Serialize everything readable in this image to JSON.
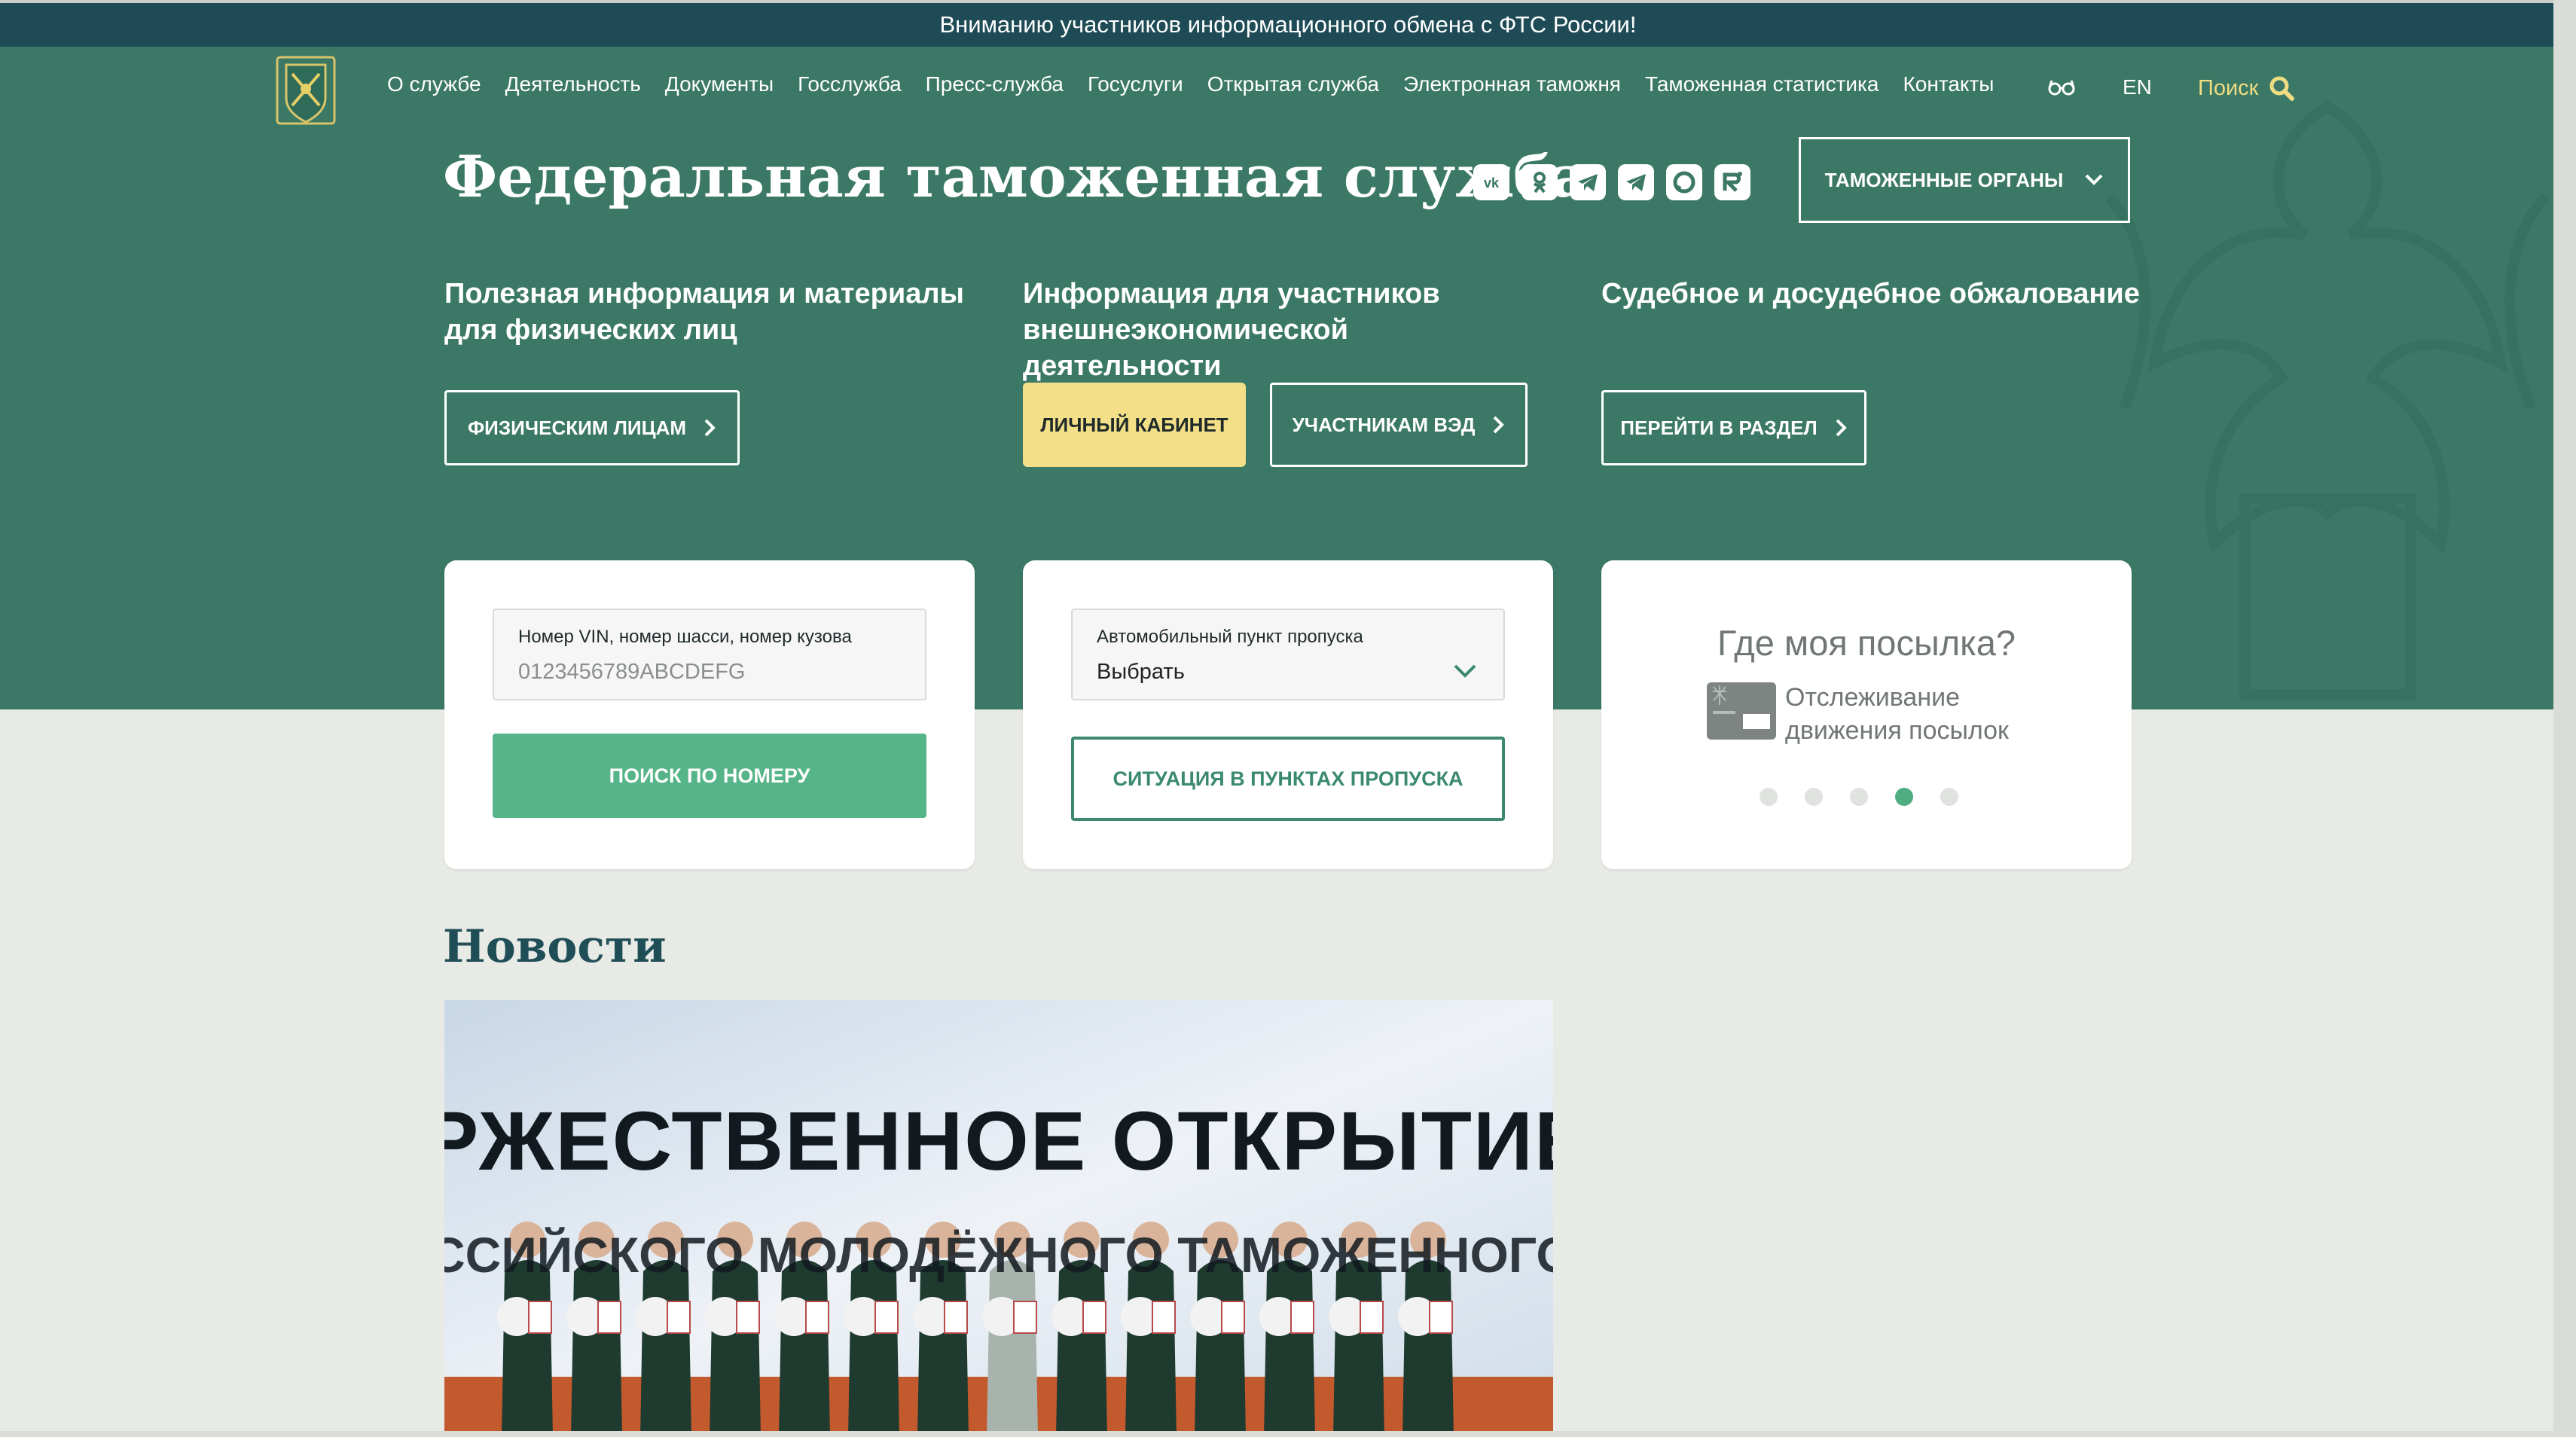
{
  "announcement": "Вниманию участников информационного обмена с ФТС России!",
  "nav": {
    "items": [
      "О службе",
      "Деятельность",
      "Документы",
      "Госслужба",
      "Пресс-служба",
      "Госуслуги",
      "Открытая служба",
      "Электронная таможня",
      "Таможенная статистика",
      "Контакты"
    ],
    "lang": "EN",
    "search_label": "Поиск"
  },
  "site_title": "Федеральная таможенная служба",
  "socials": [
    "vk-icon",
    "odnoklassniki-icon",
    "telegram-icon",
    "telegram-icon",
    "max-icon",
    "rutube-icon"
  ],
  "customs_bodies_label": "ТАМОЖЕННЫЕ ОРГАНЫ",
  "sections": {
    "individuals": {
      "title": "Полезная информация и материалы для физических лиц",
      "button": "ФИЗИЧЕСКИМ ЛИЦАМ"
    },
    "foreign_trade": {
      "title": "Информация для участников внешнеэкономической деятельности",
      "cabinet_button": "ЛИЧНЫЙ КАБИНЕТ",
      "button": "УЧАСТНИКАМ ВЭД"
    },
    "appeal": {
      "title": "Судебное и досудебное обжалование",
      "button": "ПЕРЕЙТИ В РАЗДЕЛ"
    }
  },
  "vin_card": {
    "label": "Номер VIN, номер шасси, номер кузова",
    "placeholder": "0123456789ABCDEFG",
    "button": "ПОИСК ПО НОМЕРУ"
  },
  "checkpoint_card": {
    "label": "Автомобильный пункт пропуска",
    "selected": "Выбрать",
    "button": "СИТУАЦИЯ В ПУНКТАХ ПРОПУСКА"
  },
  "parcel_card": {
    "title": "Где моя посылка?",
    "subtitle_line1": "Отслеживание",
    "subtitle_line2": "движения посылок",
    "slide_count": 5,
    "active_slide": 4
  },
  "news": {
    "title": "Новости",
    "banner_line1": "РЖЕСТВЕННОЕ ОТКРЫТИЕ",
    "banner_line2": "ССИЙСКОГО МОЛОДЁЖНОГО ТАМОЖЕННОГО ФОР"
  },
  "colors": {
    "hero": "#3b7866",
    "announcement_bar": "#1e4b55",
    "accent_yellow": "#f3df87",
    "button_green": "#55b488",
    "news_title": "#1f4e57"
  }
}
